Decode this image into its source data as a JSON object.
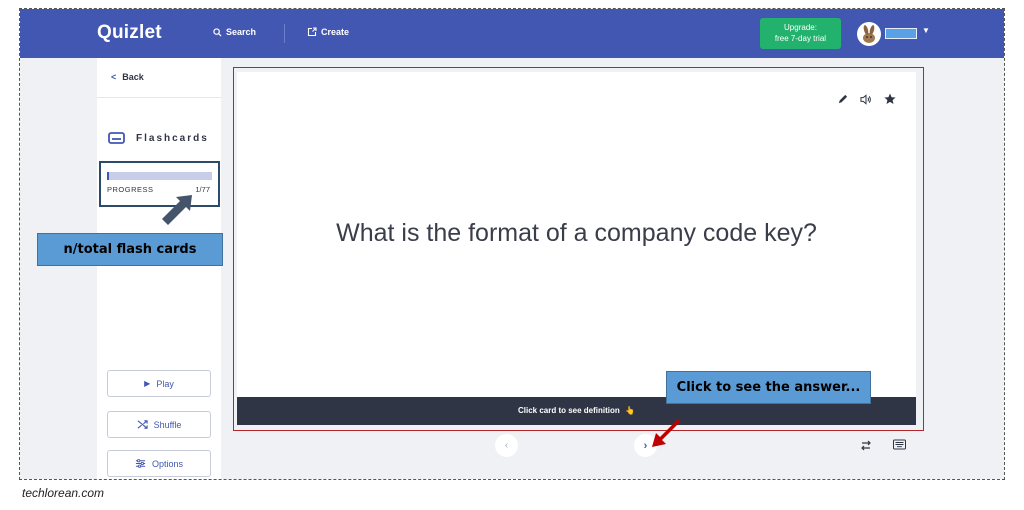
{
  "header": {
    "logo": "Quizlet",
    "search_label": "Search",
    "create_label": "Create",
    "upgrade_line1": "Upgrade:",
    "upgrade_line2": "free 7-day trial",
    "colors": {
      "bar": "#4257b2",
      "upgrade": "#23b26d"
    }
  },
  "sidebar": {
    "back_label": "Back",
    "mode_label": "Flashcards",
    "progress": {
      "label": "PROGRESS",
      "count": "1/77",
      "current": 1,
      "total": 77
    },
    "buttons": {
      "play": "Play",
      "shuffle": "Shuffle",
      "options": "Options"
    }
  },
  "card": {
    "term": "What is the format of a company code key?",
    "footer": "Click card to see definition",
    "footer_emoji": "👆",
    "icons": [
      "pencil-icon",
      "audio-icon",
      "star-icon"
    ]
  },
  "annotations": {
    "count_callout": "n/total flash cards",
    "answer_callout": "Click to see the answer..."
  },
  "watermark": "techlorean.com"
}
